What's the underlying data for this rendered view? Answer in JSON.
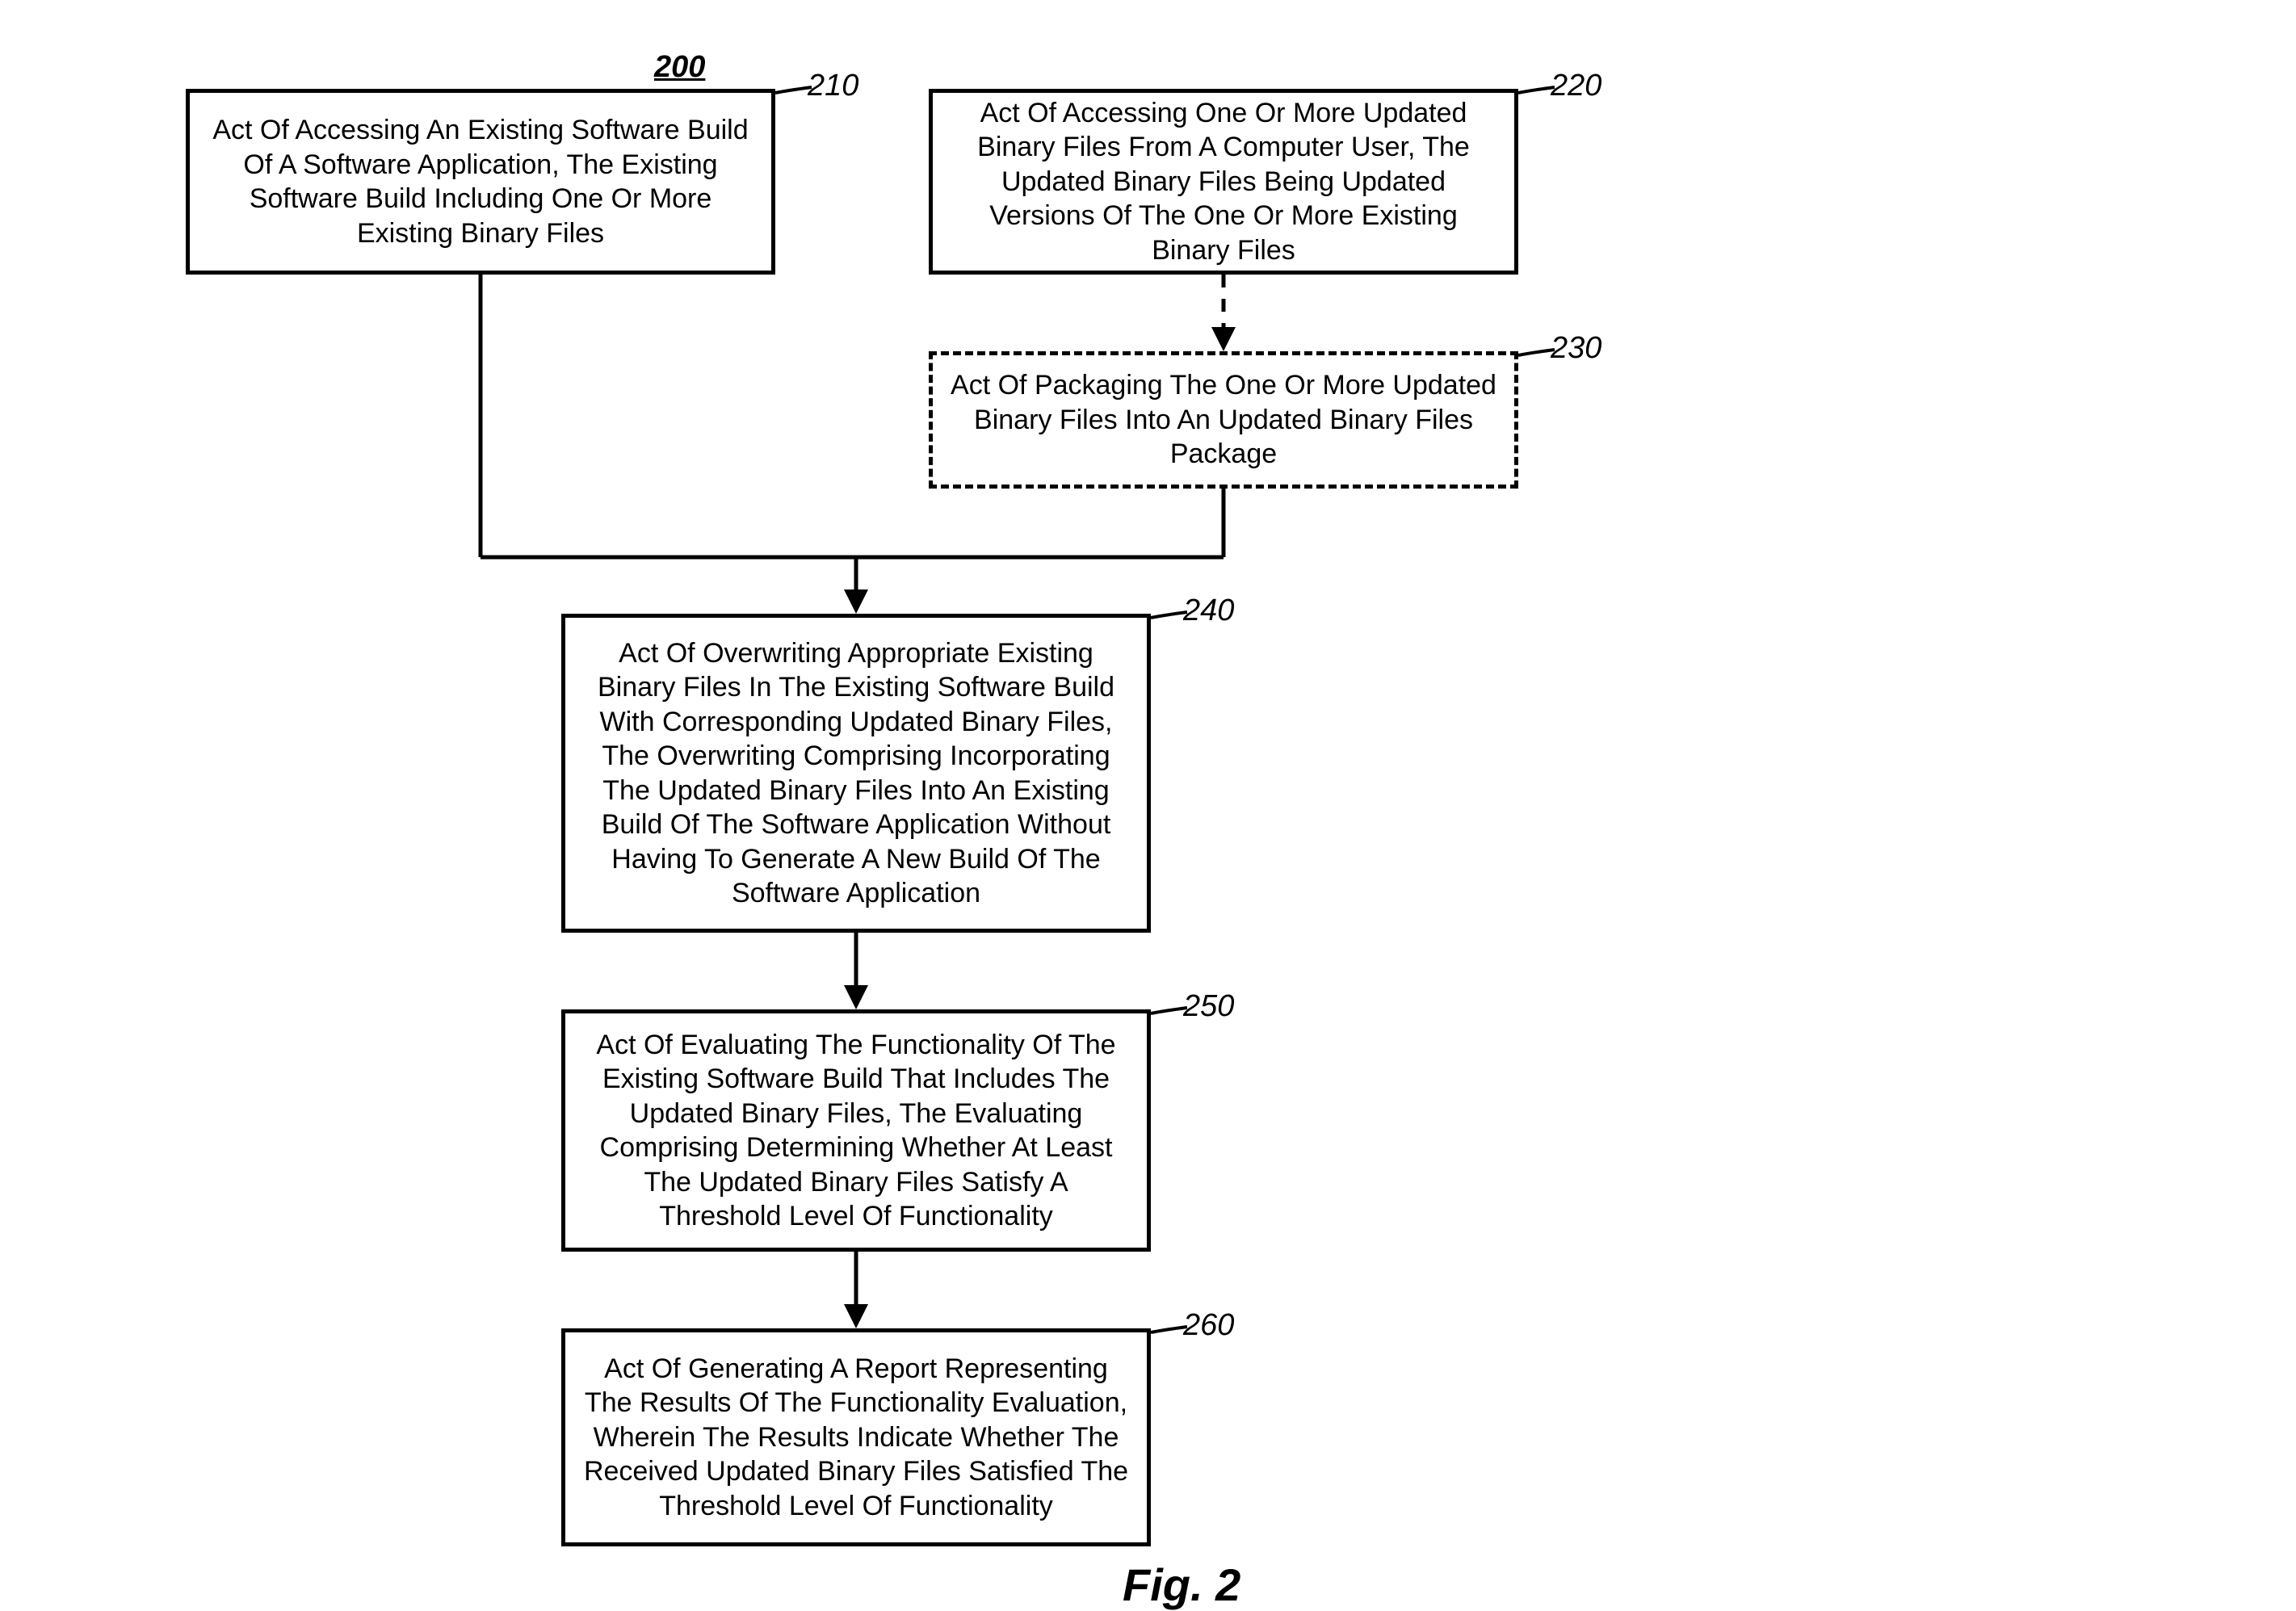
{
  "title_ref": "200",
  "boxes": {
    "b210": "Act Of Accessing An Existing Software Build Of A Software Application, The Existing Software Build Including One Or More Existing Binary Files",
    "b220": "Act Of Accessing One Or More Updated Binary Files From A Computer User, The Updated Binary Files Being Updated Versions Of The One Or More Existing Binary Files",
    "b230": "Act Of Packaging The One Or More Updated Binary Files Into An Updated Binary Files Package",
    "b240": "Act Of Overwriting Appropriate Existing Binary Files In The Existing Software Build With Corresponding Updated Binary Files, The Overwriting Comprising Incorporating The Updated Binary Files Into An Existing Build Of The Software Application Without Having To Generate A New Build Of The Software Application",
    "b250": "Act Of Evaluating The Functionality Of The Existing Software Build That Includes The Updated Binary Files, The Evaluating Comprising Determining Whether At Least The Updated Binary Files Satisfy A Threshold Level Of Functionality",
    "b260": "Act Of Generating A Report Representing The Results Of The Functionality Evaluation, Wherein The Results Indicate Whether The Received Updated Binary Files Satisfied The Threshold Level Of Functionality"
  },
  "refs": {
    "r210": "210",
    "r220": "220",
    "r230": "230",
    "r240": "240",
    "r250": "250",
    "r260": "260"
  },
  "figure_caption": "Fig. 2"
}
